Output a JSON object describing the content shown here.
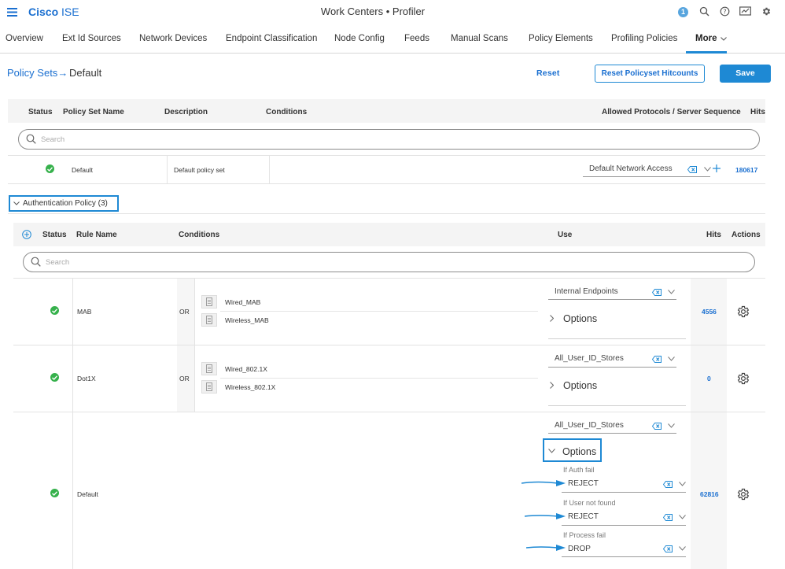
{
  "header": {
    "brand_bold": "Cisco",
    "brand_rest": " ISE",
    "title": "Work Centers • Profiler",
    "notification_count": "1",
    "icons": [
      "menu-icon",
      "search-icon",
      "help-icon",
      "dashboard-icon",
      "settings-icon"
    ]
  },
  "tabs": [
    {
      "label": "Overview"
    },
    {
      "label": "Ext Id Sources"
    },
    {
      "label": "Network Devices"
    },
    {
      "label": "Endpoint Classification"
    },
    {
      "label": "Node Config"
    },
    {
      "label": "Feeds"
    },
    {
      "label": "Manual Scans"
    },
    {
      "label": "Policy Elements"
    },
    {
      "label": "Profiling Policies"
    }
  ],
  "more_tab": {
    "label": "More",
    "selected": true
  },
  "breadcrumb": {
    "link": "Policy Sets",
    "arrow": "→",
    "current": "Default"
  },
  "actions": {
    "reset": "Reset",
    "reset_hitcounts": "Reset Policyset Hitcounts",
    "save": "Save"
  },
  "policy_sets": {
    "headers": {
      "status": "Status",
      "name": "Policy Set Name",
      "description": "Description",
      "conditions": "Conditions",
      "protocols": "Allowed Protocols / Server Sequence",
      "hits": "Hits"
    },
    "search_placeholder": "Search",
    "row": {
      "status": "ok",
      "name": "Default",
      "description": "Default policy set",
      "protocol": "Default Network Access",
      "hits": "180617"
    }
  },
  "auth_policy": {
    "title": "Authentication Policy (3)",
    "expanded": true,
    "headers": {
      "status": "Status",
      "rule": "Rule Name",
      "conditions": "Conditions",
      "use": "Use",
      "hits": "Hits",
      "actions": "Actions"
    },
    "search_placeholder": "Search",
    "rules": [
      {
        "name": "MAB",
        "op": "OR",
        "conditions": [
          "Wired_MAB",
          "Wireless_MAB"
        ],
        "use": "Internal Endpoints",
        "options": "Options",
        "hits": "4556"
      },
      {
        "name": "Dot1X",
        "op": "OR",
        "conditions": [
          "Wired_802.1X",
          "Wireless_802.1X"
        ],
        "use": "All_User_ID_Stores",
        "options": "Options",
        "hits": "0"
      },
      {
        "name": "Default",
        "use": "All_User_ID_Stores",
        "options": "Options",
        "hits": "62816",
        "if_auth_fail_label": "If Auth fail",
        "if_auth_fail": "REJECT",
        "if_user_not_found_label": "If User not found",
        "if_user_not_found": "REJECT",
        "if_process_fail_label": "If Process fail",
        "if_process_fail": "DROP"
      }
    ]
  },
  "colors": {
    "accent": "#1e89d4",
    "link": "#1a6fd0",
    "status_ok": "#36b14c"
  }
}
